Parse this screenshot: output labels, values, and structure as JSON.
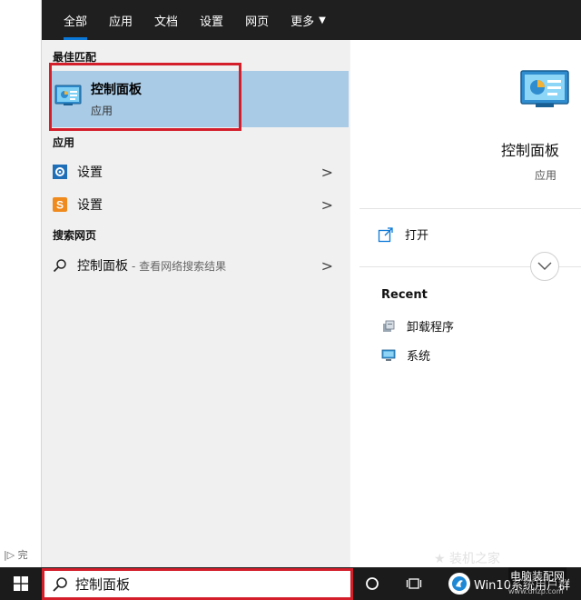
{
  "background": {
    "status_char": "完"
  },
  "tabs": [
    {
      "label": "全部",
      "active": true
    },
    {
      "label": "应用",
      "active": false
    },
    {
      "label": "文档",
      "active": false
    },
    {
      "label": "设置",
      "active": false
    },
    {
      "label": "网页",
      "active": false
    },
    {
      "label": "更多",
      "active": false
    }
  ],
  "best_match": {
    "heading": "最佳匹配",
    "title": "控制面板",
    "subtitle": "应用",
    "icon": "control-panel-icon"
  },
  "apps": {
    "heading": "应用",
    "items": [
      {
        "label": "设置",
        "icon": "gear-icon"
      },
      {
        "label": "设置",
        "icon": "sogou-s-icon"
      }
    ]
  },
  "web_search": {
    "heading": "搜索网页",
    "query": "控制面板",
    "hint": "- 查看网络搜索结果",
    "icon": "search-icon"
  },
  "detail": {
    "title": "控制面板",
    "subtitle": "应用",
    "open_label": "打开",
    "recent_heading": "Recent",
    "recent_items": [
      {
        "label": "卸载程序",
        "icon": "uninstall-icon"
      },
      {
        "label": "系统",
        "icon": "system-icon"
      }
    ]
  },
  "taskbar": {
    "search_text": "控制面板",
    "watermark_text": "Win10系统用户群",
    "site_title": "电脑装配网",
    "site_url": "www.dnzp.com",
    "faint_text": "★ 装机之家"
  },
  "colors": {
    "accent": "#0a78d7",
    "highlight_border": "#d41f2b",
    "best_match_bg": "#a9cbe6",
    "taskbar_bg": "#1b1b1b"
  }
}
